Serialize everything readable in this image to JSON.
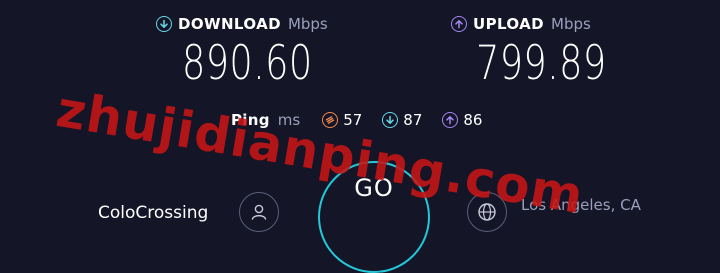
{
  "download": {
    "label": "DOWNLOAD",
    "unit": "Mbps",
    "value": "890.60",
    "icon": "download-arrow-icon",
    "color": "#67d8e8"
  },
  "upload": {
    "label": "UPLOAD",
    "unit": "Mbps",
    "value": "799.89",
    "icon": "upload-arrow-icon",
    "color": "#a386ef"
  },
  "ping": {
    "label": "Ping",
    "unit": "ms",
    "idle": {
      "value": "57",
      "icon": "idle-latency-icon",
      "color": "#f28a4e"
    },
    "download": {
      "value": "87",
      "icon": "download-latency-icon",
      "color": "#67d8e8"
    },
    "upload": {
      "value": "86",
      "icon": "upload-latency-icon",
      "color": "#a386ef"
    }
  },
  "server": {
    "name": "ColoCrossing",
    "icon": "user-icon",
    "location": "Los Angeles, CA",
    "location_icon": "globe-icon"
  },
  "go_button": {
    "label": "GO",
    "color": "#24c7d8"
  },
  "watermark": {
    "text": "zhujidianping.com",
    "color": "#c81616"
  }
}
